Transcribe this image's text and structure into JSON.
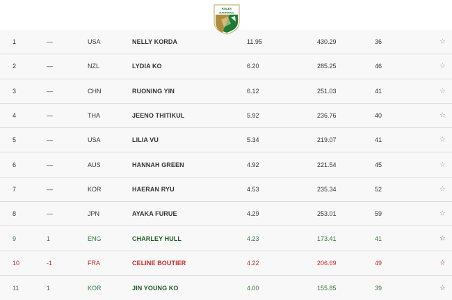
{
  "logo": {
    "brand": "ROLEX",
    "label": "RANKINGS"
  },
  "rows": [
    {
      "rank": "1",
      "move": "—",
      "country": "USA",
      "name": "NELLY KORDA",
      "avg": "11.95",
      "total": "430.29",
      "events": "36",
      "trend": "same"
    },
    {
      "rank": "2",
      "move": "—",
      "country": "NZL",
      "name": "LYDIA KO",
      "avg": "6.20",
      "total": "285.25",
      "events": "46",
      "trend": "same"
    },
    {
      "rank": "3",
      "move": "—",
      "country": "CHN",
      "name": "RUONING YIN",
      "avg": "6.12",
      "total": "251.03",
      "events": "41",
      "trend": "same"
    },
    {
      "rank": "4",
      "move": "—",
      "country": "THA",
      "name": "JEENO THITIKUL",
      "avg": "5.92",
      "total": "236.76",
      "events": "40",
      "trend": "same"
    },
    {
      "rank": "5",
      "move": "—",
      "country": "USA",
      "name": "LILIA VU",
      "avg": "5.34",
      "total": "219.07",
      "events": "41",
      "trend": "same"
    },
    {
      "rank": "6",
      "move": "—",
      "country": "AUS",
      "name": "HANNAH GREEN",
      "avg": "4.92",
      "total": "221.54",
      "events": "45",
      "trend": "same"
    },
    {
      "rank": "7",
      "move": "—",
      "country": "KOR",
      "name": "HAERAN RYU",
      "avg": "4.53",
      "total": "235.34",
      "events": "52",
      "trend": "same"
    },
    {
      "rank": "8",
      "move": "—",
      "country": "JPN",
      "name": "AYAKA FURUE",
      "avg": "4.29",
      "total": "253.01",
      "events": "59",
      "trend": "same"
    },
    {
      "rank": "9",
      "move": "1",
      "country": "ENG",
      "name": "CHARLEY HULL",
      "avg": "4.23",
      "total": "173.41",
      "events": "41",
      "trend": "up"
    },
    {
      "rank": "10",
      "move": "-1",
      "country": "FRA",
      "name": "CELINE BOUTIER",
      "avg": "4.22",
      "total": "206.69",
      "events": "49",
      "trend": "down"
    },
    {
      "rank": "11",
      "move": "1",
      "country": "KOR",
      "name": "JIN YOUNG KO",
      "avg": "4.00",
      "total": "155.85",
      "events": "39",
      "trend": "up"
    }
  ],
  "favorite_icon": "☆",
  "colors": {
    "up": "#2e7d32",
    "down": "#c62828",
    "neutral": "#333333",
    "logo_green": "#1e7b34",
    "logo_gold": "#b08d3c"
  }
}
